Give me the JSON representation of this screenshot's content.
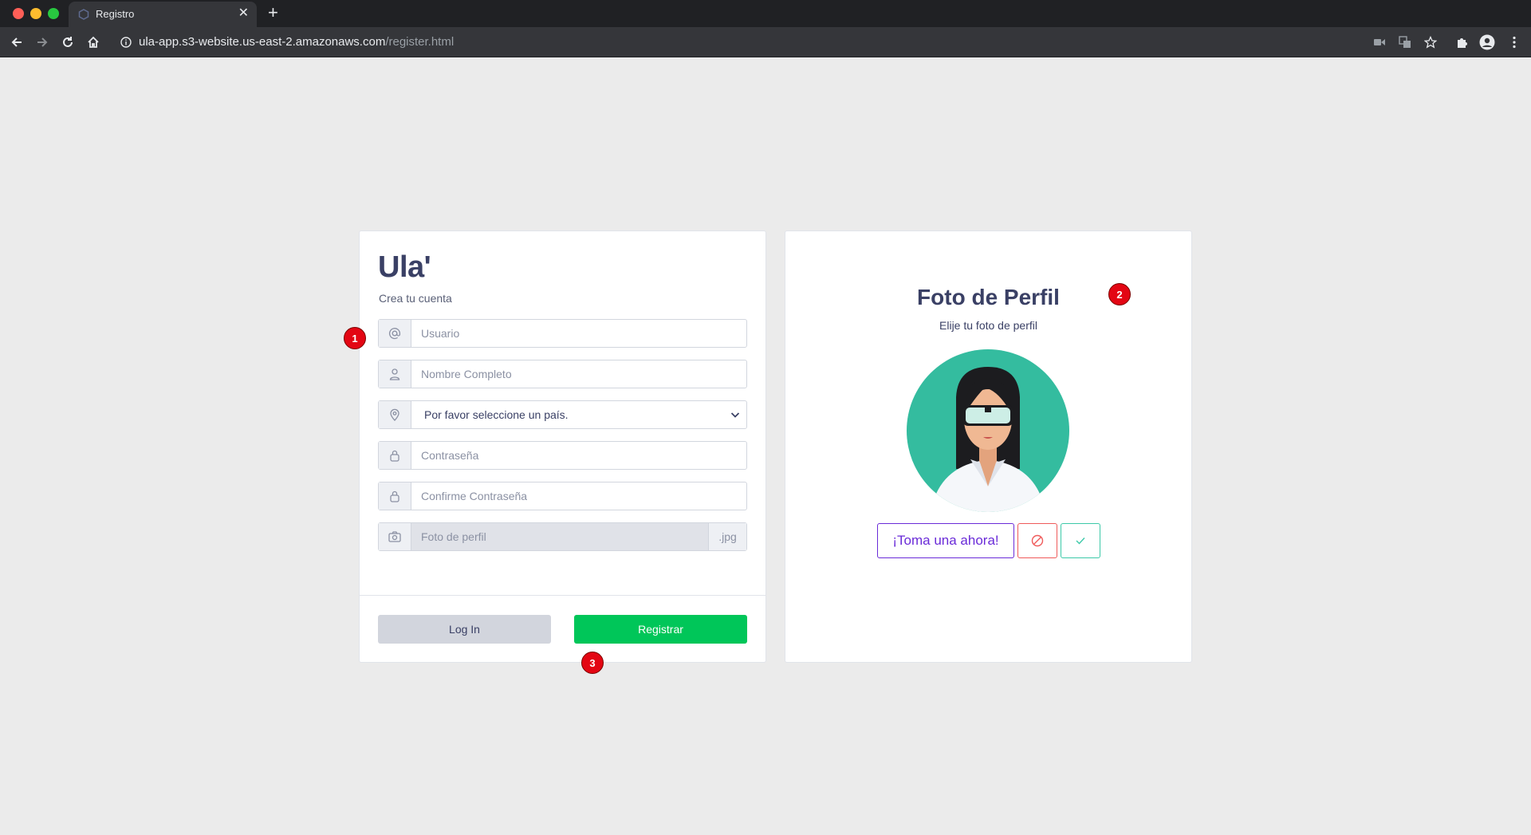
{
  "browser": {
    "tab_title": "Registro",
    "new_tab_label": "+",
    "url_host": "ula-app.s3-website.us-east-2.amazonaws.com",
    "url_path": "/register.html"
  },
  "register": {
    "brand": "Ula'",
    "subtitle": "Crea tu cuenta",
    "username_placeholder": "Usuario",
    "fullname_placeholder": "Nombre Completo",
    "country_selected": "Por favor seleccione un país.",
    "password_placeholder": "Contraseña",
    "confirm_password_placeholder": "Confirme Contraseña",
    "photo_placeholder": "Foto de perfil",
    "photo_ext": ".jpg",
    "login_label": "Log In",
    "register_label": "Registrar"
  },
  "profile_photo": {
    "title": "Foto de Perfil",
    "subtitle": "Elije tu foto de perfil",
    "take_label": "¡Toma una ahora!"
  },
  "markers": [
    "1",
    "2",
    "3"
  ],
  "colors": {
    "accent_green": "#00c659",
    "accent_purple": "#6a2bd8",
    "danger_red": "#ef5a5a",
    "confirm_teal": "#3cc9a8",
    "text_dark": "#3a4065"
  }
}
